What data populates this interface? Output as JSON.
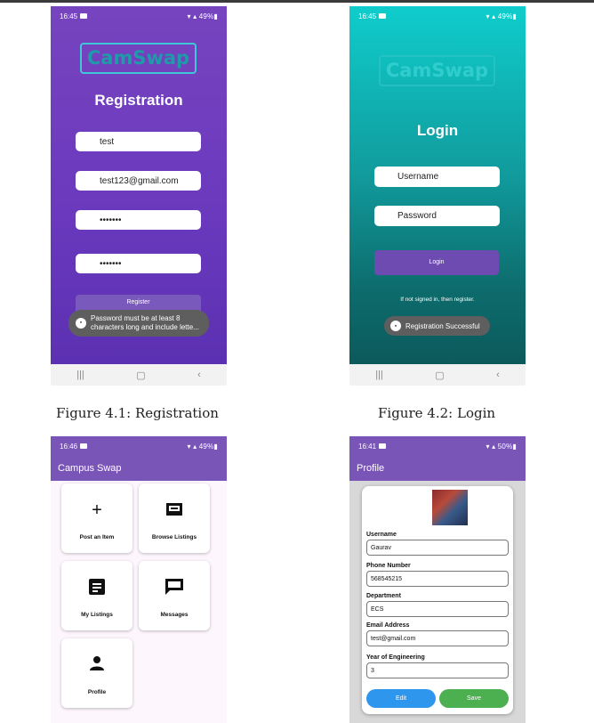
{
  "figures": [
    {
      "number": "Figure 4.1:",
      "title": "Registration"
    },
    {
      "number": "Figure 4.2:",
      "title": "Login"
    }
  ],
  "registration": {
    "status": {
      "time": "16:45",
      "right": "49%"
    },
    "logo": "CamSwap",
    "title": "Registration",
    "fields": [
      "test",
      "test123@gmail.com",
      "•••••••",
      "•••••••"
    ],
    "button": "Register",
    "toast": "Password must be at least 8 characters long and include lette..."
  },
  "login": {
    "status": {
      "time": "16:45",
      "right": "49%"
    },
    "logo": "CamSwap",
    "title": "Login",
    "username_placeholder": "Username",
    "password_placeholder": "Password",
    "button": "Login",
    "hint": "If not signed in, then register.",
    "toast": "Registration Successful"
  },
  "home": {
    "status": {
      "time": "16:46",
      "right": "49%"
    },
    "app_title": "Campus Swap",
    "tiles": [
      {
        "label": "Post an Item",
        "icon": "plus-icon"
      },
      {
        "label": "Browse Listings",
        "icon": "browse-icon"
      },
      {
        "label": "My Listings",
        "icon": "list-icon"
      },
      {
        "label": "Messages",
        "icon": "message-icon"
      },
      {
        "label": "Profile",
        "icon": "person-icon"
      }
    ]
  },
  "profile": {
    "status": {
      "time": "16:41",
      "right": "50%"
    },
    "app_title": "Profile",
    "fields": [
      {
        "label": "Username",
        "value": "Gaurav"
      },
      {
        "label": "Phone Number",
        "value": "568545215"
      },
      {
        "label": "Department",
        "value": "ECS"
      },
      {
        "label": "Email Address",
        "value": "test@gmail.com"
      },
      {
        "label": "Year of Engineering",
        "value": "3"
      }
    ],
    "edit_label": "Edit",
    "save_label": "Save",
    "colors": {
      "edit": "#2f96ee",
      "save": "#4caf50"
    }
  }
}
